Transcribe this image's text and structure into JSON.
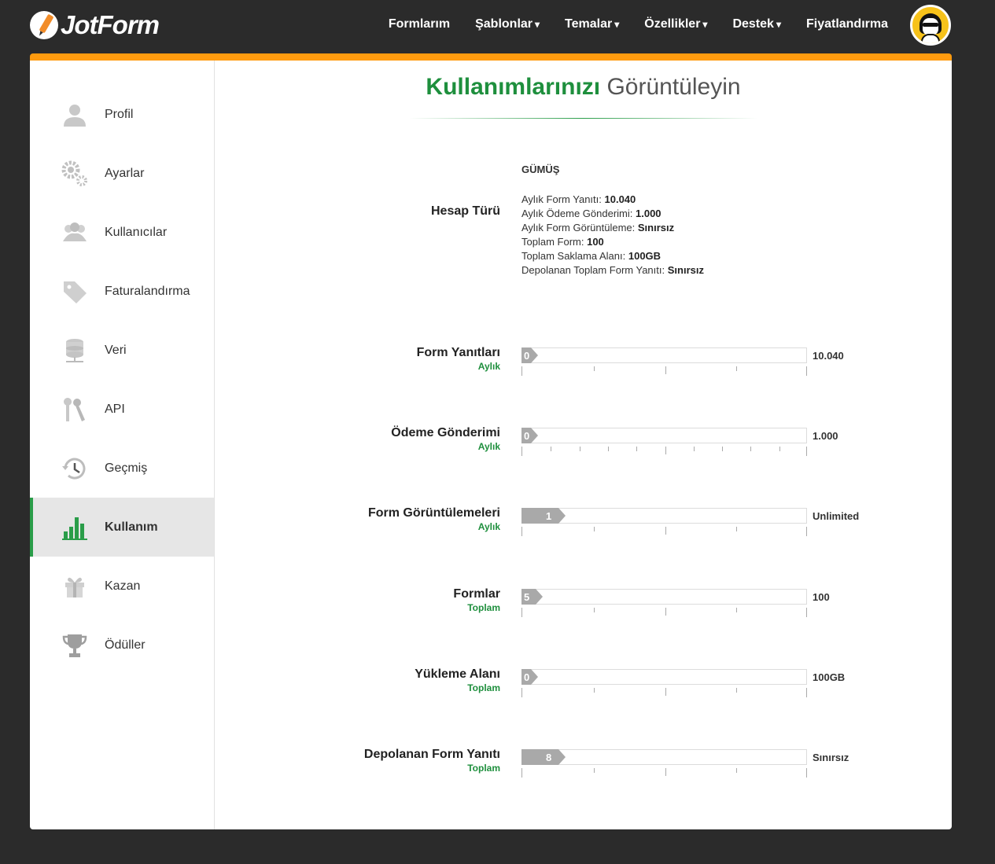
{
  "header": {
    "logo_text": "JotForm",
    "nav": [
      {
        "label": "Formlarım",
        "caret": ""
      },
      {
        "label": "Şablonlar",
        "caret": "▾"
      },
      {
        "label": "Temalar",
        "caret": "▾"
      },
      {
        "label": "Özellikler",
        "caret": "▾"
      },
      {
        "label": "Destek",
        "caret": "▾"
      },
      {
        "label": "Fiyatlandırma",
        "caret": ""
      }
    ]
  },
  "sidebar": {
    "items": [
      {
        "label": "Profil",
        "icon": "user-icon"
      },
      {
        "label": "Ayarlar",
        "icon": "gears-icon"
      },
      {
        "label": "Kullanıcılar",
        "icon": "users-icon"
      },
      {
        "label": "Faturalandırma",
        "icon": "tag-icon"
      },
      {
        "label": "Veri",
        "icon": "database-icon"
      },
      {
        "label": "API",
        "icon": "keys-icon"
      },
      {
        "label": "Geçmiş",
        "icon": "history-icon"
      },
      {
        "label": "Kullanım",
        "icon": "bar-chart-icon",
        "active": true
      },
      {
        "label": "Kazan",
        "icon": "gift-icon"
      },
      {
        "label": "Ödüller",
        "icon": "trophy-icon"
      }
    ]
  },
  "page": {
    "title_bold": "Kullanımlarınızı",
    "title_rest": "Görüntüleyin"
  },
  "account": {
    "label": "Hesap Türü",
    "plan": "GÜMÜŞ",
    "lines": [
      {
        "key": "Aylık Form Yanıtı:",
        "value": "10.040"
      },
      {
        "key": "Aylık Ödeme Gönderimi:",
        "value": "1.000"
      },
      {
        "key": "Aylık Form Görüntüleme:",
        "value": "Sınırsız"
      },
      {
        "key": "Toplam Form:",
        "value": "100"
      },
      {
        "key": "Toplam Saklama Alanı:",
        "value": "100GB"
      },
      {
        "key": "Depolanan Toplam Form Yanıtı:",
        "value": "Sınırsız"
      }
    ]
  },
  "meters": [
    {
      "title": "Form Yanıtları",
      "period": "Aylık",
      "used": "0",
      "used_fraction": 0.0,
      "max": "10.040"
    },
    {
      "title": "Ödeme Gönderimi",
      "period": "Aylık",
      "used": "0",
      "used_fraction": 0.0,
      "max": "1.000"
    },
    {
      "title": "Form Görüntülemeleri",
      "period": "Aylık",
      "used": "1",
      "used_fraction": 0.13,
      "max": "Unlimited"
    },
    {
      "title": "Formlar",
      "period": "Toplam",
      "used": "5",
      "used_fraction": 0.05,
      "max": "100"
    },
    {
      "title": "Yükleme Alanı",
      "period": "Toplam",
      "used": "0",
      "used_fraction": 0.0,
      "max": "100GB"
    },
    {
      "title": "Depolanan Form Yanıtı",
      "period": "Toplam",
      "used": "8",
      "used_fraction": 0.13,
      "max": "Sınırsız"
    }
  ],
  "colors": {
    "accent_orange": "#ff9b0f",
    "accent_green": "#1e8f3d",
    "background": "#2b2b2b"
  }
}
